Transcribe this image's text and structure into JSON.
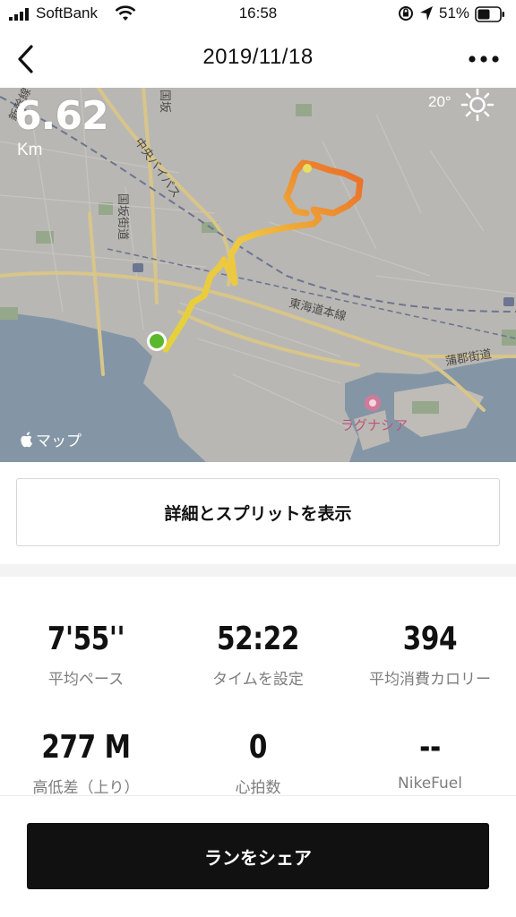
{
  "status_bar": {
    "carrier": "SoftBank",
    "time": "16:58",
    "battery": "51%"
  },
  "nav": {
    "title": "2019/11/18"
  },
  "map": {
    "distance": "6.62",
    "distance_unit": "Km",
    "temperature": "20°",
    "attribution": "マップ",
    "labels": {
      "bypass": "中央バイパス",
      "kokuho_top": "国坂",
      "kokuho_street": "国坂街道",
      "shinkansen": "新幹線",
      "tokaido": "東海道本線",
      "gamagori": "蒲郡街道",
      "lagunasia": "ラグナシア"
    }
  },
  "details_button": "詳細とスプリットを表示",
  "stats": [
    {
      "value": "7'55''",
      "label": "平均ペース"
    },
    {
      "value": "52:22",
      "label": "タイムを設定"
    },
    {
      "value": "394",
      "label": "平均消費カロリー"
    },
    {
      "value": "277 M",
      "label": "高低差（上り）"
    },
    {
      "value": "0",
      "label": "心拍数"
    },
    {
      "value": "--",
      "label": "NikeFuel"
    }
  ],
  "share_button": "ランをシェア",
  "colors": {
    "map_land": "#b9b7b3",
    "map_water": "#7e93a6",
    "route_start": "#e0d040",
    "route_end": "#e8702a",
    "start_marker": "#5ab82c"
  }
}
